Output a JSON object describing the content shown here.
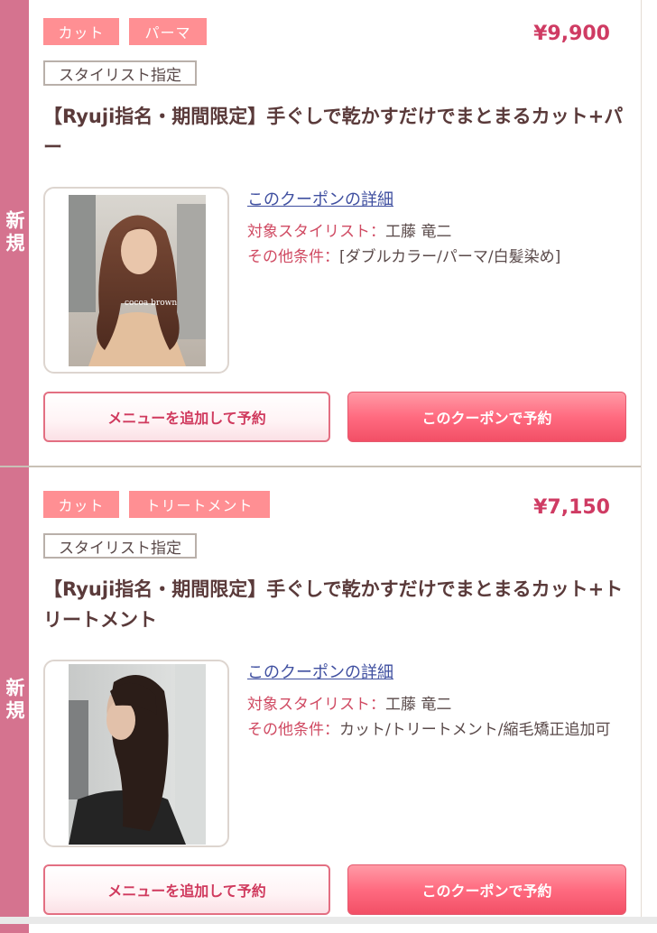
{
  "coupons": [
    {
      "ribbon": "新規",
      "tags": [
        "カット",
        "パーマ"
      ],
      "price": "¥9,900",
      "stylist_tag": "スタイリスト指定",
      "title": "【Ryuji指名・期間限定】手ぐしで乾かすだけでまとまるカット+パー",
      "photo_text": "cocoa brown",
      "detail_link": "このクーポンの詳細",
      "stylist_label": "対象スタイリスト：",
      "stylist_value": "工藤 竜二",
      "conditions_label": "その他条件：",
      "conditions_value": "[ダブルカラー/パーマ/白髪染め]",
      "add_menu_button": "メニューを追加して予約",
      "reserve_button": "このクーポンで予約"
    },
    {
      "ribbon": "新規",
      "tags": [
        "カット",
        "トリートメント"
      ],
      "price": "¥7,150",
      "stylist_tag": "スタイリスト指定",
      "title": "【Ryuji指名・期間限定】手ぐしで乾かすだけでまとまるカット+トリートメント",
      "detail_link": "このクーポンの詳細",
      "stylist_label": "対象スタイリスト：",
      "stylist_value": "工藤 竜二",
      "conditions_label": "その他条件：",
      "conditions_value": "カット/トリートメント/縮毛矯正追加可",
      "add_menu_button": "メニューを追加して予約",
      "reserve_button": "このクーポンで予約"
    }
  ],
  "colors": {
    "ribbon": "#d5738f",
    "tag": "#ff8f93",
    "price": "#cf3b63",
    "label": "#d04b63",
    "link": "#3f4fa0",
    "button_fill": "#ff6b80"
  }
}
